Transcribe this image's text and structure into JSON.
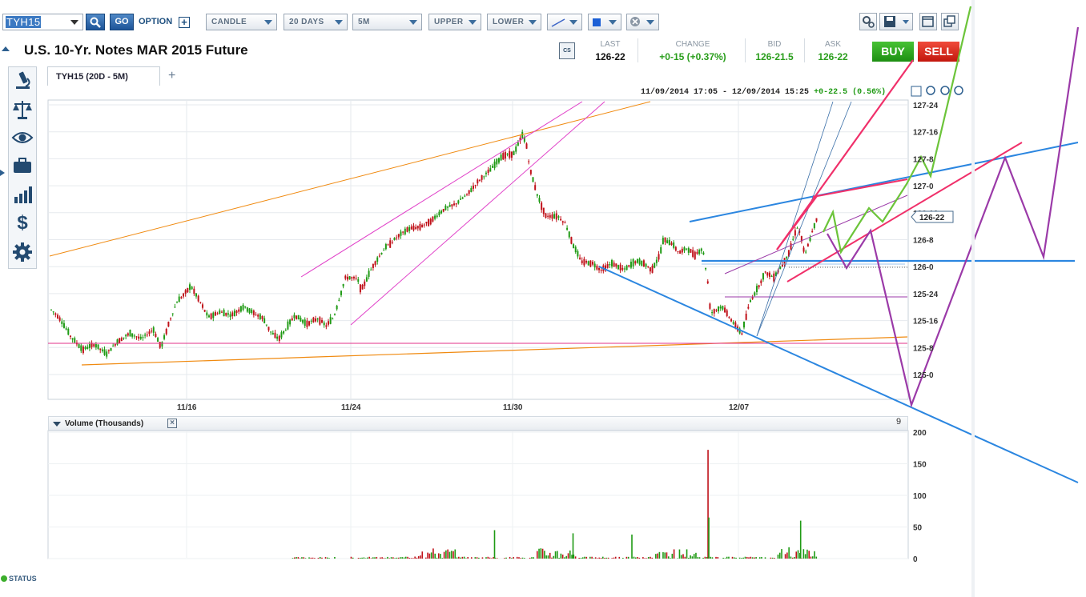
{
  "toolbar": {
    "symbol": "TYH15",
    "go_label": "GO",
    "option_label": "OPTION",
    "chart_type": "CANDLE",
    "range": "20 DAYS",
    "interval": "5M",
    "upper": "UPPER",
    "lower": "LOWER"
  },
  "instrument": {
    "title": "U.S. 10-Yr. Notes MAR 2015 Future"
  },
  "quote": {
    "last_label": "LAST",
    "last": "126-22",
    "change_label": "CHANGE",
    "change": "+0-15 (+0.37%)",
    "bid_label": "BID",
    "bid": "126-21.5",
    "ask_label": "ASK",
    "ask": "126-22",
    "buy_label": "BUY",
    "sell_label": "SELL"
  },
  "tabs": [
    {
      "label": "TYH15 (20D - 5M)"
    }
  ],
  "chart_header": {
    "date_range": "11/09/2014 17:05 - 12/09/2014 15:25",
    "change": "+0-22.5 (0.56%)"
  },
  "volume_panel": {
    "title": "Volume (Thousands)",
    "corner_value": "9"
  },
  "status": {
    "label": "STATUS"
  },
  "colors": {
    "up_candle": "#1f9a14",
    "down_candle": "#c0121a",
    "price_line_blue": "#2b86e0",
    "pink": "#f0306a",
    "green_projection": "#6cc43a",
    "purple_projection": "#9b3aa8",
    "orange": "#f08a10",
    "magenta": "#e040c8"
  },
  "chart_data": {
    "type": "candlestick",
    "x_tick_labels": [
      "11/16",
      "11/24",
      "11/30",
      "12/07"
    ],
    "y_tick_labels": [
      "127-24",
      "127-16",
      "127-8",
      "127-0",
      "126-16",
      "126-8",
      "126-0",
      "125-24",
      "125-16",
      "125-8",
      "125-0"
    ],
    "current_price_label": "126-22",
    "price_path": [
      [
        0,
        125.85
      ],
      [
        0.01,
        125.78
      ],
      [
        0.025,
        125.6
      ],
      [
        0.04,
        125.48
      ],
      [
        0.055,
        125.53
      ],
      [
        0.07,
        125.44
      ],
      [
        0.085,
        125.56
      ],
      [
        0.1,
        125.63
      ],
      [
        0.115,
        125.58
      ],
      [
        0.13,
        125.67
      ],
      [
        0.14,
        125.5
      ],
      [
        0.15,
        125.73
      ],
      [
        0.16,
        125.92
      ],
      [
        0.17,
        126.0
      ],
      [
        0.178,
        126.07
      ],
      [
        0.19,
        125.92
      ],
      [
        0.2,
        125.78
      ],
      [
        0.215,
        125.83
      ],
      [
        0.23,
        125.8
      ],
      [
        0.245,
        125.88
      ],
      [
        0.26,
        125.81
      ],
      [
        0.27,
        125.77
      ],
      [
        0.28,
        125.64
      ],
      [
        0.29,
        125.58
      ],
      [
        0.3,
        125.68
      ],
      [
        0.31,
        125.8
      ],
      [
        0.325,
        125.72
      ],
      [
        0.34,
        125.77
      ],
      [
        0.35,
        125.7
      ],
      [
        0.36,
        125.78
      ],
      [
        0.375,
        126.15
      ],
      [
        0.39,
        126.14
      ],
      [
        0.395,
        126.03
      ],
      [
        0.41,
        126.26
      ],
      [
        0.425,
        126.42
      ],
      [
        0.44,
        126.52
      ],
      [
        0.455,
        126.6
      ],
      [
        0.47,
        126.62
      ],
      [
        0.485,
        126.68
      ],
      [
        0.5,
        126.78
      ],
      [
        0.515,
        126.83
      ],
      [
        0.53,
        126.92
      ],
      [
        0.545,
        127.05
      ],
      [
        0.56,
        127.15
      ],
      [
        0.575,
        127.28
      ],
      [
        0.59,
        127.3
      ],
      [
        0.6,
        127.47
      ],
      [
        0.605,
        127.4
      ],
      [
        0.61,
        127.15
      ],
      [
        0.62,
        126.9
      ],
      [
        0.63,
        126.72
      ],
      [
        0.645,
        126.72
      ],
      [
        0.655,
        126.65
      ],
      [
        0.665,
        126.45
      ],
      [
        0.675,
        126.3
      ],
      [
        0.69,
        126.28
      ],
      [
        0.7,
        126.22
      ],
      [
        0.715,
        126.28
      ],
      [
        0.73,
        126.22
      ],
      [
        0.745,
        126.3
      ],
      [
        0.755,
        126.28
      ],
      [
        0.765,
        126.22
      ],
      [
        0.775,
        126.35
      ],
      [
        0.78,
        126.5
      ],
      [
        0.79,
        126.47
      ],
      [
        0.8,
        126.38
      ],
      [
        0.81,
        126.42
      ],
      [
        0.82,
        126.36
      ],
      [
        0.83,
        126.42
      ],
      [
        0.837,
        126.08
      ],
      [
        0.84,
        125.82
      ],
      [
        0.855,
        125.88
      ],
      [
        0.87,
        125.72
      ],
      [
        0.88,
        125.63
      ],
      [
        0.89,
        125.92
      ],
      [
        0.9,
        126.05
      ],
      [
        0.91,
        126.2
      ],
      [
        0.92,
        126.15
      ],
      [
        0.93,
        126.25
      ],
      [
        0.94,
        126.38
      ],
      [
        0.945,
        126.5
      ],
      [
        0.95,
        126.62
      ],
      [
        0.955,
        126.55
      ],
      [
        0.96,
        126.35
      ],
      [
        0.97,
        126.58
      ],
      [
        0.975,
        126.68
      ]
    ],
    "volume_spikes": [
      {
        "x": 0.837,
        "value": 172
      },
      {
        "x": 0.837,
        "value": 65
      },
      {
        "x": 0.955,
        "value": 60
      },
      {
        "x": 0.565,
        "value": 45
      },
      {
        "x": 0.665,
        "value": 40
      },
      {
        "x": 0.74,
        "value": 38
      }
    ],
    "volume_axis": [
      0,
      50,
      100,
      150,
      200
    ],
    "annotations": [
      "orange long-term trendlines",
      "magenta rising channel",
      "blue falling trendline",
      "blue rising trendline",
      "horizontal blue support line",
      "pink wedge",
      "green projected path",
      "purple projected path"
    ]
  }
}
